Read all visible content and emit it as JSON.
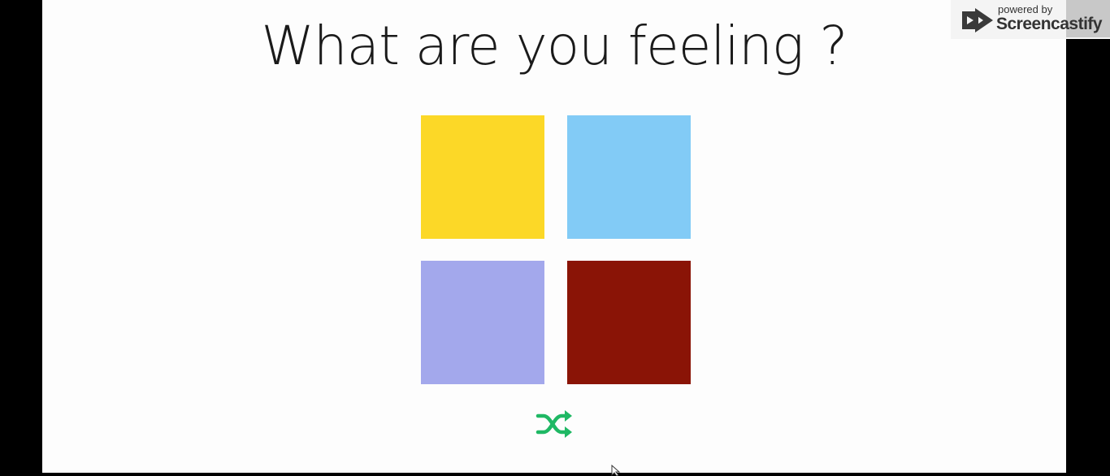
{
  "title": "What are you feeling ?",
  "tiles": [
    {
      "color": "#fcd827"
    },
    {
      "color": "#82cbf6"
    },
    {
      "color": "#a3a8ec"
    },
    {
      "color": "#8a1406"
    }
  ],
  "shuffle": {
    "icon": "shuffle-icon",
    "color": "#1fb864"
  },
  "watermark": {
    "line1": "powered by",
    "line2": "Screencastify"
  }
}
